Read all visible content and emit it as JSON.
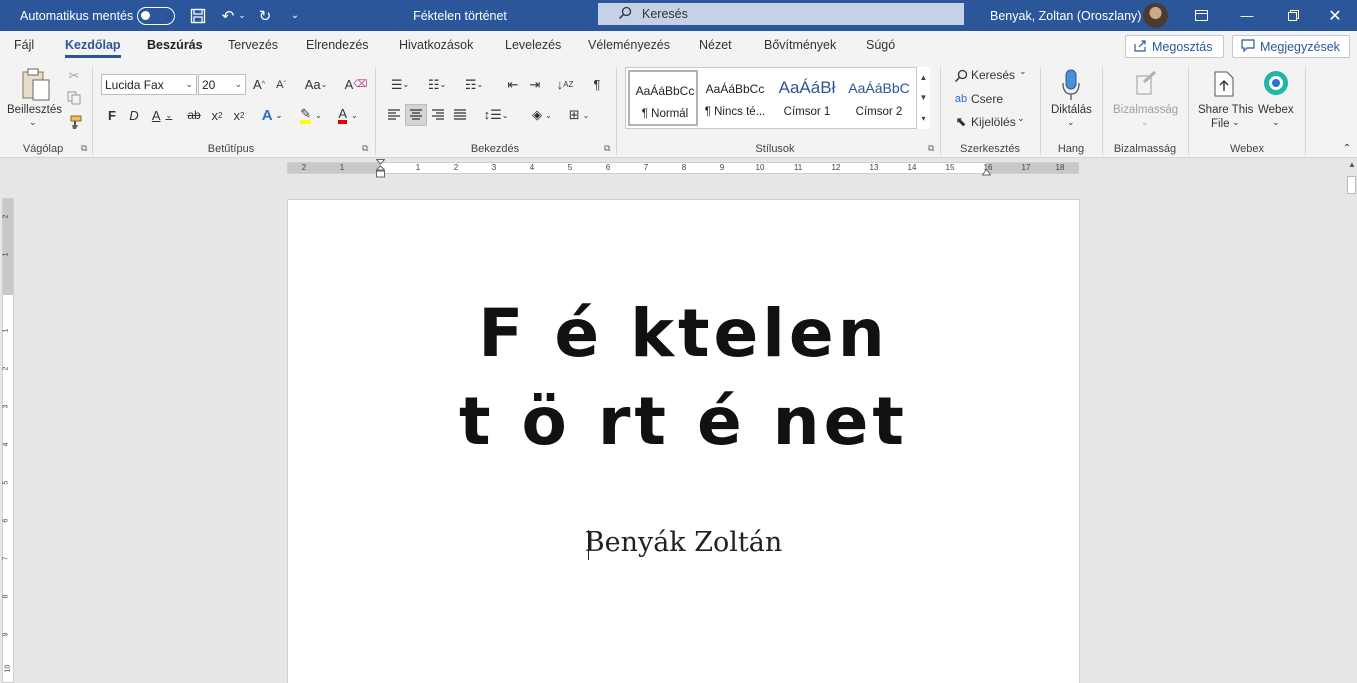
{
  "titlebar": {
    "autosave_label": "Automatikus mentés",
    "doc_title": "Féktelen történet",
    "search_placeholder": "Keresés",
    "user_name": "Benyak, Zoltan (Oroszlany)"
  },
  "tabs": [
    "Fájl",
    "Kezdőlap",
    "Beszúrás",
    "Tervezés",
    "Elrendezés",
    "Hivatkozások",
    "Levelezés",
    "Véleményezés",
    "Nézet",
    "Bővítmények",
    "Súgó"
  ],
  "share_label": "Megosztás",
  "comments_label": "Megjegyzések",
  "ribbon": {
    "clipboard": {
      "paste": "Beillesztés",
      "group": "Vágólap"
    },
    "font": {
      "name": "Lucida Fax",
      "size": "20",
      "group": "Betűtípus"
    },
    "paragraph": {
      "group": "Bekezdés"
    },
    "styles": {
      "group": "Stílusok",
      "items": [
        {
          "preview": "AaÁáBbCc",
          "name": "¶ Normál"
        },
        {
          "preview": "AaÁáBbCc",
          "name": "¶ Nincs té..."
        },
        {
          "preview": "AaÁáBł",
          "name": "Címsor 1"
        },
        {
          "preview": "AaÁáBbC",
          "name": "Címsor 2"
        }
      ]
    },
    "editing": {
      "find": "Keresés",
      "replace": "Csere",
      "select": "Kijelölés",
      "group": "Szerkesztés"
    },
    "voice": {
      "dictate": "Diktálás",
      "group": "Hang"
    },
    "sensitivity": {
      "label": "Bizalmasság",
      "group": "Bizalmasság"
    },
    "webex": {
      "share_line1": "Share This",
      "share_line2": "File",
      "webex": "Webex",
      "group": "Webex"
    }
  },
  "ruler": {
    "h_left": [
      "2",
      "1"
    ],
    "h_right": [
      "1",
      "2",
      "3",
      "4",
      "5",
      "6",
      "7",
      "8",
      "9",
      "10",
      "11",
      "12",
      "13",
      "14",
      "15",
      "16",
      "17",
      "18"
    ],
    "v_top": [
      "2",
      "1"
    ],
    "v_main": [
      "1",
      "2",
      "3",
      "4",
      "5",
      "6",
      "7",
      "8",
      "9",
      "10"
    ]
  },
  "document": {
    "heading": "F é ktelen\nt ö rt é net",
    "author": "Benyák Zoltán"
  },
  "colors": {
    "accent": "#2b579a",
    "highlight": "#ffff00",
    "font_color": "#e00000"
  }
}
